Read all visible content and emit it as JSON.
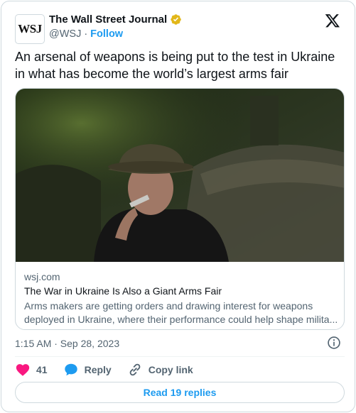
{
  "author": {
    "logo_text": "WSJ",
    "display_name": "The Wall Street Journal",
    "handle": "@WSJ",
    "separator": "·",
    "follow_label": "Follow",
    "verified_color": "#e2b719"
  },
  "tweet": {
    "text": "An arsenal of weapons is being put to the test in Ukraine in what has become the world’s largest arms fair",
    "timestamp": "1:15 AM · Sep 28, 2023"
  },
  "link_card": {
    "domain": "wsj.com",
    "title": "The War in Ukraine Is Also a Giant Arms Fair",
    "description_line1": "Arms makers are getting orders and drawing interest for weapons",
    "description_line2": "deployed in Ukraine, where their performance could help shape milita..."
  },
  "actions": {
    "like_count": "41",
    "reply_label": "Reply",
    "copy_link_label": "Copy link",
    "read_replies_label": "Read 19 replies"
  },
  "colors": {
    "accent": "#1d9bf0",
    "like": "#f91880",
    "reply": "#1d9bf0",
    "muted": "#536471"
  },
  "icons": [
    "verified-badge-icon",
    "x-logo-icon",
    "info-icon",
    "heart-icon",
    "reply-bubble-icon",
    "link-icon"
  ]
}
